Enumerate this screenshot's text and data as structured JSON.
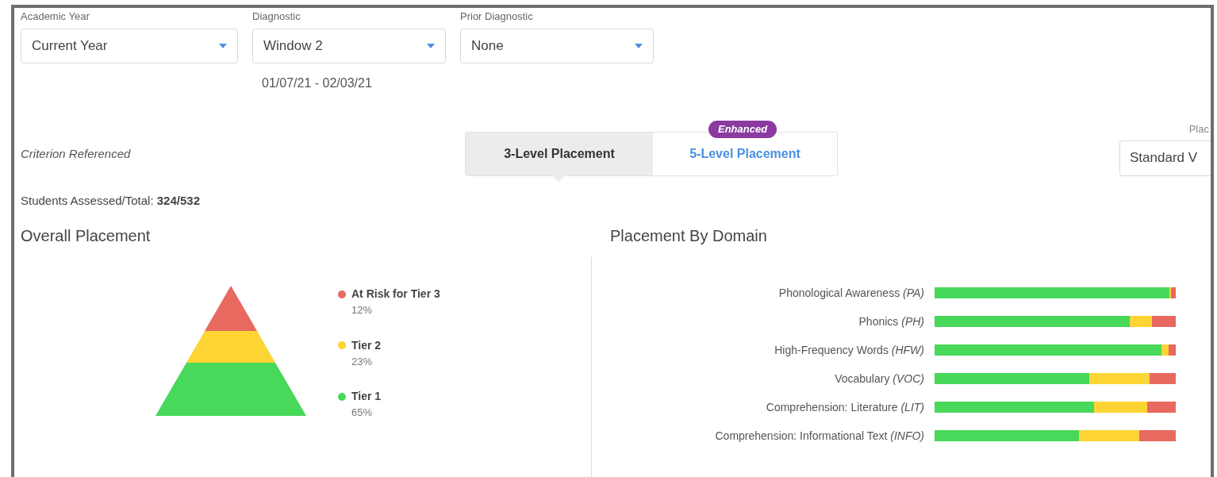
{
  "filters": [
    {
      "label": "Academic Year",
      "value": "Current Year"
    },
    {
      "label": "Diagnostic",
      "value": "Window 2",
      "note": "01/07/21 - 02/03/21"
    },
    {
      "label": "Prior Diagnostic",
      "value": "None"
    }
  ],
  "scale_label": "Criterion Referenced",
  "tabs": [
    {
      "label": "3-Level Placement",
      "selected": true
    },
    {
      "label": "5-Level Placement",
      "selected": false,
      "badge": "Enhanced"
    }
  ],
  "placement_type": {
    "label": "Plac",
    "value": "Standard V"
  },
  "students": {
    "label": "Students Assessed/Total:",
    "value": "324/532"
  },
  "overall": {
    "title": "Overall Placement",
    "legend": [
      {
        "label": "At Risk for Tier 3",
        "percent": "12%",
        "color": "#e8695f"
      },
      {
        "label": "Tier 2",
        "percent": "23%",
        "color": "#fcd535"
      },
      {
        "label": "Tier 1",
        "percent": "65%",
        "color": "#48d85a"
      }
    ]
  },
  "domain": {
    "title": "Placement By Domain",
    "rows": [
      {
        "label": "Phonological Awareness *(PA)*"
      },
      {
        "label": "Phonics *(PH)*"
      },
      {
        "label": "High-Frequency Words *(HFW)*"
      },
      {
        "label": "Vocabulary *(VOC)*"
      },
      {
        "label": "Comprehension: Literature *(LIT)*"
      },
      {
        "label": "Comprehension: Informational Text *(INFO)*"
      }
    ]
  }
}
